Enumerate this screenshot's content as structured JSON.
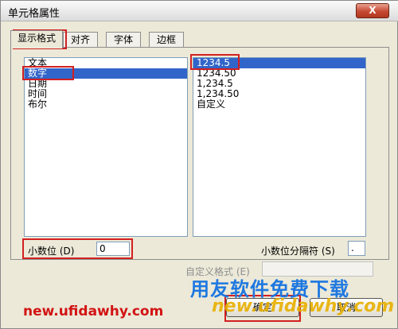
{
  "window": {
    "title": "单元格属性",
    "close_label": "X"
  },
  "tabs": [
    {
      "label": "显示格式",
      "active": true
    },
    {
      "label": "对齐",
      "active": false
    },
    {
      "label": "字体",
      "active": false
    },
    {
      "label": "边框",
      "active": false
    }
  ],
  "category_list": {
    "items": [
      "文本",
      "数字",
      "日期",
      "时间",
      "布尔"
    ],
    "selected": "数字"
  },
  "format_list": {
    "items": [
      "1234.5",
      "1234.50",
      "1,234.5",
      "1,234.50",
      "自定义"
    ],
    "selected": "1234.5"
  },
  "decimal_places": {
    "label": "小数位 (D)",
    "value": "0"
  },
  "separator": {
    "label": "小数位分隔符 (S)",
    "value": "."
  },
  "custom_format": {
    "label": "自定义格式 (E)",
    "value": ""
  },
  "buttons": {
    "ok": "确定",
    "cancel": "取消"
  },
  "watermarks": {
    "site_left": "new.ufidawhy.com",
    "site_right": "new.ufidawhy.com",
    "slogan": "用友软件免费下载"
  },
  "colors": {
    "highlight": "#d22020",
    "selection": "#3165c9"
  }
}
